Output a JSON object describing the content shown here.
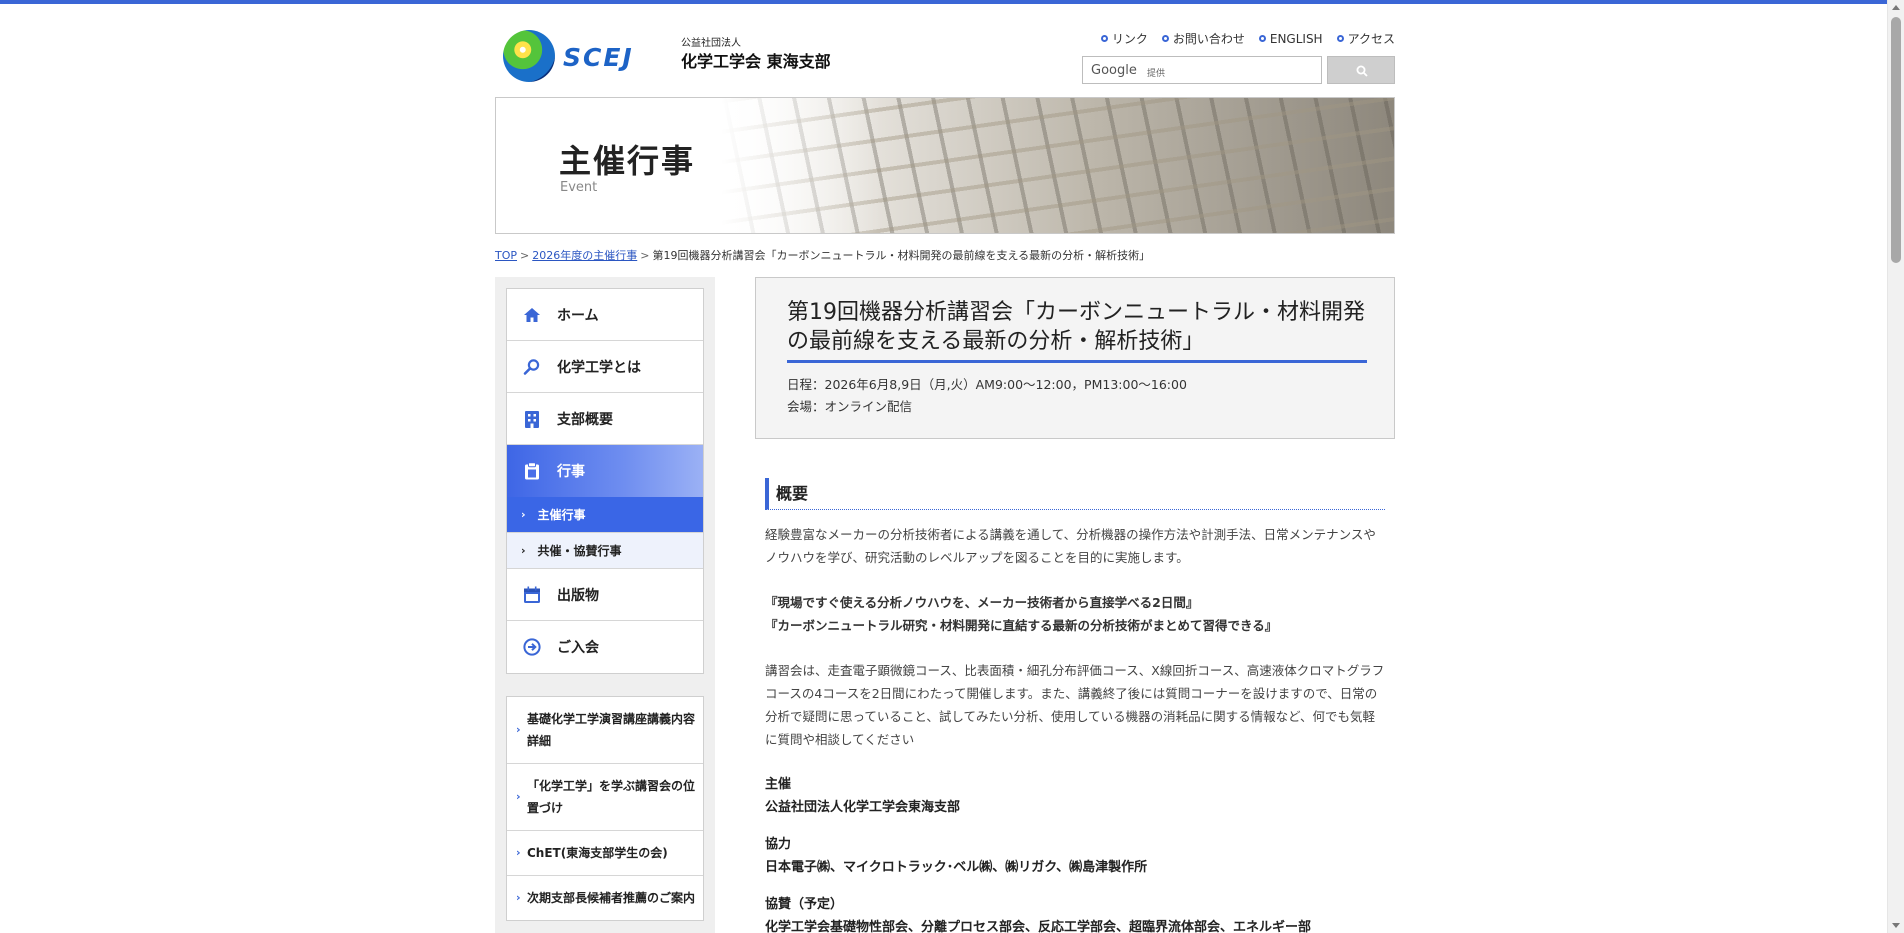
{
  "header": {
    "logo_word": "SCEJ",
    "org_sub": "公益社団法人",
    "org_main": "化学工学会 東海支部",
    "links": [
      {
        "label": "リンク"
      },
      {
        "label": "お問い合わせ"
      },
      {
        "label": "ENGLISH"
      },
      {
        "label": "アクセス"
      }
    ],
    "search": {
      "google_label": "Google",
      "provided_label": "提供",
      "button_icon": "search-icon"
    }
  },
  "banner": {
    "title": "主催行事",
    "subtitle": "Event"
  },
  "breadcrumb": {
    "items": [
      "TOP",
      "2026年度の主催行事"
    ],
    "current": "第19回機器分析講習会「カーボンニュートラル・材料開発の最前線を支える最新の分析・解析技術」",
    "separator": ">"
  },
  "sidebar": {
    "nav": [
      {
        "label": "ホーム",
        "icon": "home-icon"
      },
      {
        "label": "化学工学とは",
        "icon": "magnifier-icon"
      },
      {
        "label": "支部概要",
        "icon": "building-icon"
      },
      {
        "label": "行事",
        "icon": "clipboard-icon"
      },
      {
        "label": "出版物",
        "icon": "calendar-icon"
      },
      {
        "label": "ご入会",
        "icon": "arrow-circle-icon"
      }
    ],
    "sub": [
      {
        "label": "主催行事"
      },
      {
        "label": "共催・協賛行事"
      }
    ],
    "banners": [
      {
        "label": "基礎化学工学演習講座講義内容詳細"
      },
      {
        "label": "「化学工学」を学ぶ講習会の位置づけ"
      },
      {
        "label": "ChET(東海支部学生の会)"
      },
      {
        "label": "次期支部長候補者推薦のご案内"
      }
    ],
    "accent": "#3a66e6"
  },
  "event": {
    "title": "第19回機器分析講習会「カーボンニュートラル・材料開発の最前線を支える最新の分析・解析技術」",
    "date": "日程：2026年6月8,9日（月,火）AM9:00～12:00，PM13:00～16:00",
    "venue": "会場：オンライン配信"
  },
  "overview": {
    "heading": "概要",
    "p1": "経験豊富なメーカーの分析技術者による講義を通して、分析機器の操作方法や計測手法、日常メンテナンスやノウハウを学び、研究活動のレベルアップを図ることを目的に実施します。",
    "emph1": "『現場ですぐ使える分析ノウハウを、メーカー技術者から直接学べる2日間』",
    "emph2": "『カーボンニュートラル研究・材料開発に直結する最新の分析技術がまとめて習得できる』",
    "p2": "講習会は、走査電子顕微鏡コース、比表面積・細孔分布評価コース、X線回折コース、高速液体クロマトグラフコースの4コースを2日間にわたって開催します。また、講義終了後には質問コーナーを設けますので、日常の分析で疑問に思っていること、試してみたい分析、使用している機器の消耗品に関する情報など、何でも気軽に質問や相談してください",
    "organizer_label": "主催",
    "organizer": "公益社団法人化学工学会東海支部",
    "coop_label": "協力",
    "coop": "日本電子㈱、マイクロトラック･ベル㈱、㈱リガク、㈱島津製作所",
    "support_label": "協賛（予定）",
    "support": "化学工学会基礎物性部会、分離プロセス部会、反応工学部会、超臨界流体部会、エネルギー部"
  }
}
